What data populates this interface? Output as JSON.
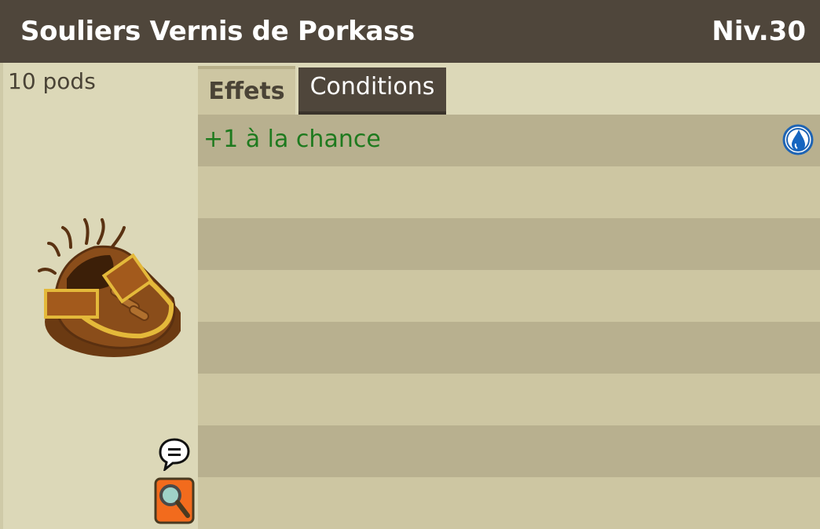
{
  "header": {
    "item_name": "Souliers Vernis de Porkass",
    "level": "Niv.30"
  },
  "left": {
    "weight": "10 pods",
    "item_icon": "brown-shoe-icon",
    "chat_icon": "speech-bubble-icon",
    "zoom_icon": "magnifier-icon"
  },
  "tabs": [
    {
      "label": "Effets",
      "active": true
    },
    {
      "label": "Conditions",
      "active": false
    }
  ],
  "effects": [
    {
      "text": "+1 à la chance",
      "element_icon": "water-drop-icon",
      "color": "#1e7a1e"
    }
  ],
  "colors": {
    "header_bg": "#4f463b",
    "panel_bg": "#dcd8b8",
    "row_dark": "#b8b08f",
    "row_light": "#cdc6a2",
    "effect_green": "#1e7a1e"
  }
}
